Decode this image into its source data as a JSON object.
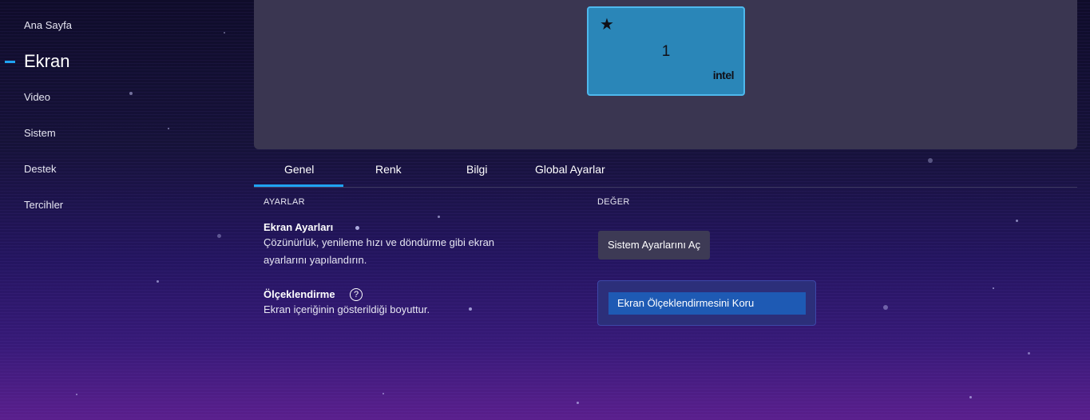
{
  "sidebar": {
    "items": [
      {
        "label": "Ana Sayfa"
      },
      {
        "label": "Ekran"
      },
      {
        "label": "Video"
      },
      {
        "label": "Sistem"
      },
      {
        "label": "Destek"
      },
      {
        "label": "Tercihler"
      }
    ],
    "active_color": "#1fa3f2"
  },
  "preview": {
    "monitor": {
      "number": "1",
      "primary_icon": "star-icon",
      "brand": "intel"
    }
  },
  "tabs": [
    {
      "label": "Genel"
    },
    {
      "label": "Renk"
    },
    {
      "label": "Bilgi"
    },
    {
      "label": "Global Ayarlar"
    }
  ],
  "table": {
    "col_settings": "AYARLAR",
    "col_value": "DEĞER"
  },
  "settings": {
    "display": {
      "title": "Ekran Ayarları",
      "desc_line1": "Çözünürlük, yenileme hızı ve döndürme gibi ekran",
      "desc_line2": "ayarlarını yapılandırın.",
      "button": "Sistem Ayarlarını Aç"
    },
    "scaling": {
      "title": "Ölçeklendirme",
      "help_icon": "help-circle-icon",
      "help_glyph": "?",
      "desc": "Ekran içeriğinin gösterildiği boyuttur.",
      "selected": "Ekran Ölçeklendirmesini Koru"
    }
  },
  "colors": {
    "accent": "#1fa3f2",
    "monitor_fill": "#2a86b8",
    "select_fill": "#1e5ab4"
  }
}
